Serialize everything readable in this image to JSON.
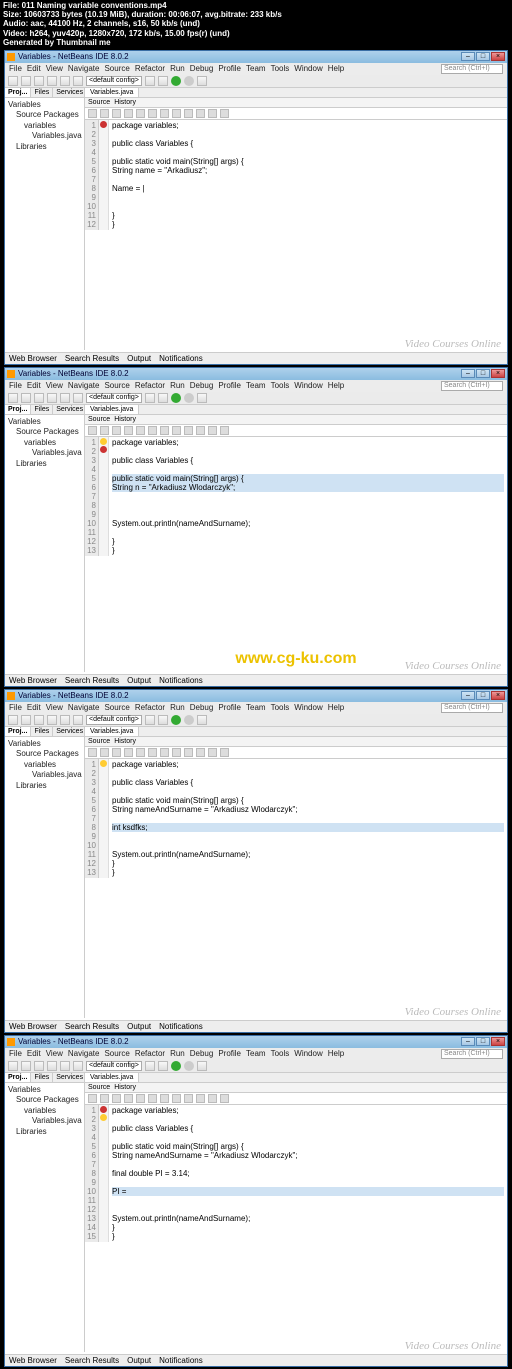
{
  "meta": {
    "file": "File: 011 Naming variable conventions.mp4",
    "size": "Size: 10603733 bytes (10.19 MiB), duration: 00:06:07, avg.bitrate: 233 kb/s",
    "audio": "Audio: aac, 44100 Hz, 2 channels, s16, 50 kb/s (und)",
    "video": "Video: h264, yuv420p, 1280x720, 172 kb/s, 15.00 fps(r) (und)",
    "gen": "Generated by Thumbnail me"
  },
  "title": "Variables - NetBeans IDE 8.0.2",
  "menu": [
    "File",
    "Edit",
    "View",
    "Navigate",
    "Source",
    "Refactor",
    "Run",
    "Debug",
    "Profile",
    "Team",
    "Tools",
    "Window",
    "Help"
  ],
  "search_ph": "Search (Ctrl+I)",
  "config": "<default config>",
  "sidetabs": {
    "proj": "Proj...",
    "files": "Files",
    "serv": "Services"
  },
  "tree": {
    "root": "Variables",
    "sp": "Source Packages",
    "pkg": "variables",
    "file": "Variables.java",
    "lib": "Libraries"
  },
  "edtab": "Variables.java",
  "subtabs": {
    "src": "Source",
    "hist": "History"
  },
  "code1": {
    "l1": "package variables;",
    "l3": "public class Variables {",
    "l5": "    public static void main(String[] args) {",
    "l6": "        String name = \"Arkadiusz\";",
    "l8": "        Name = |",
    "l11": "    }",
    "l12": "}"
  },
  "code2": {
    "l1": "package variables;",
    "l3": "public class Variables {",
    "l5": "    public static void main(String[] args) {",
    "l6": "        String n = \"Arkadiusz Wlodarczyk\";",
    "l10": "        System.out.println(nameAndSurname);",
    "l12": "    }",
    "l13": "}"
  },
  "code3": {
    "l1": "package variables;",
    "l3": "public class Variables {",
    "l5": "    public static void main(String[] args) {",
    "l6": "        String nameAndSurname = \"Arkadiusz Wlodarczyk\";",
    "l8": "        int ksdfks;",
    "l11": "        System.out.println(nameAndSurname);",
    "l12": "    }",
    "l13": "}"
  },
  "code4": {
    "l1": "package variables;",
    "l3": "public class Variables {",
    "l5": "    public static void main(String[] args) {",
    "l6": "        String nameAndSurname = \"Arkadiusz Wlodarczyk\";",
    "l8": "        final double PI = 3.14;",
    "l10": "        PI = ",
    "l13": "        System.out.println(nameAndSurname);",
    "l14": "    }",
    "l15": "}"
  },
  "status": {
    "web": "Web Browser",
    "sr": "Search Results",
    "out": "Output",
    "not": "Notifications"
  },
  "wm": "Video Courses Online",
  "cgku": "www.cg-ku.com"
}
